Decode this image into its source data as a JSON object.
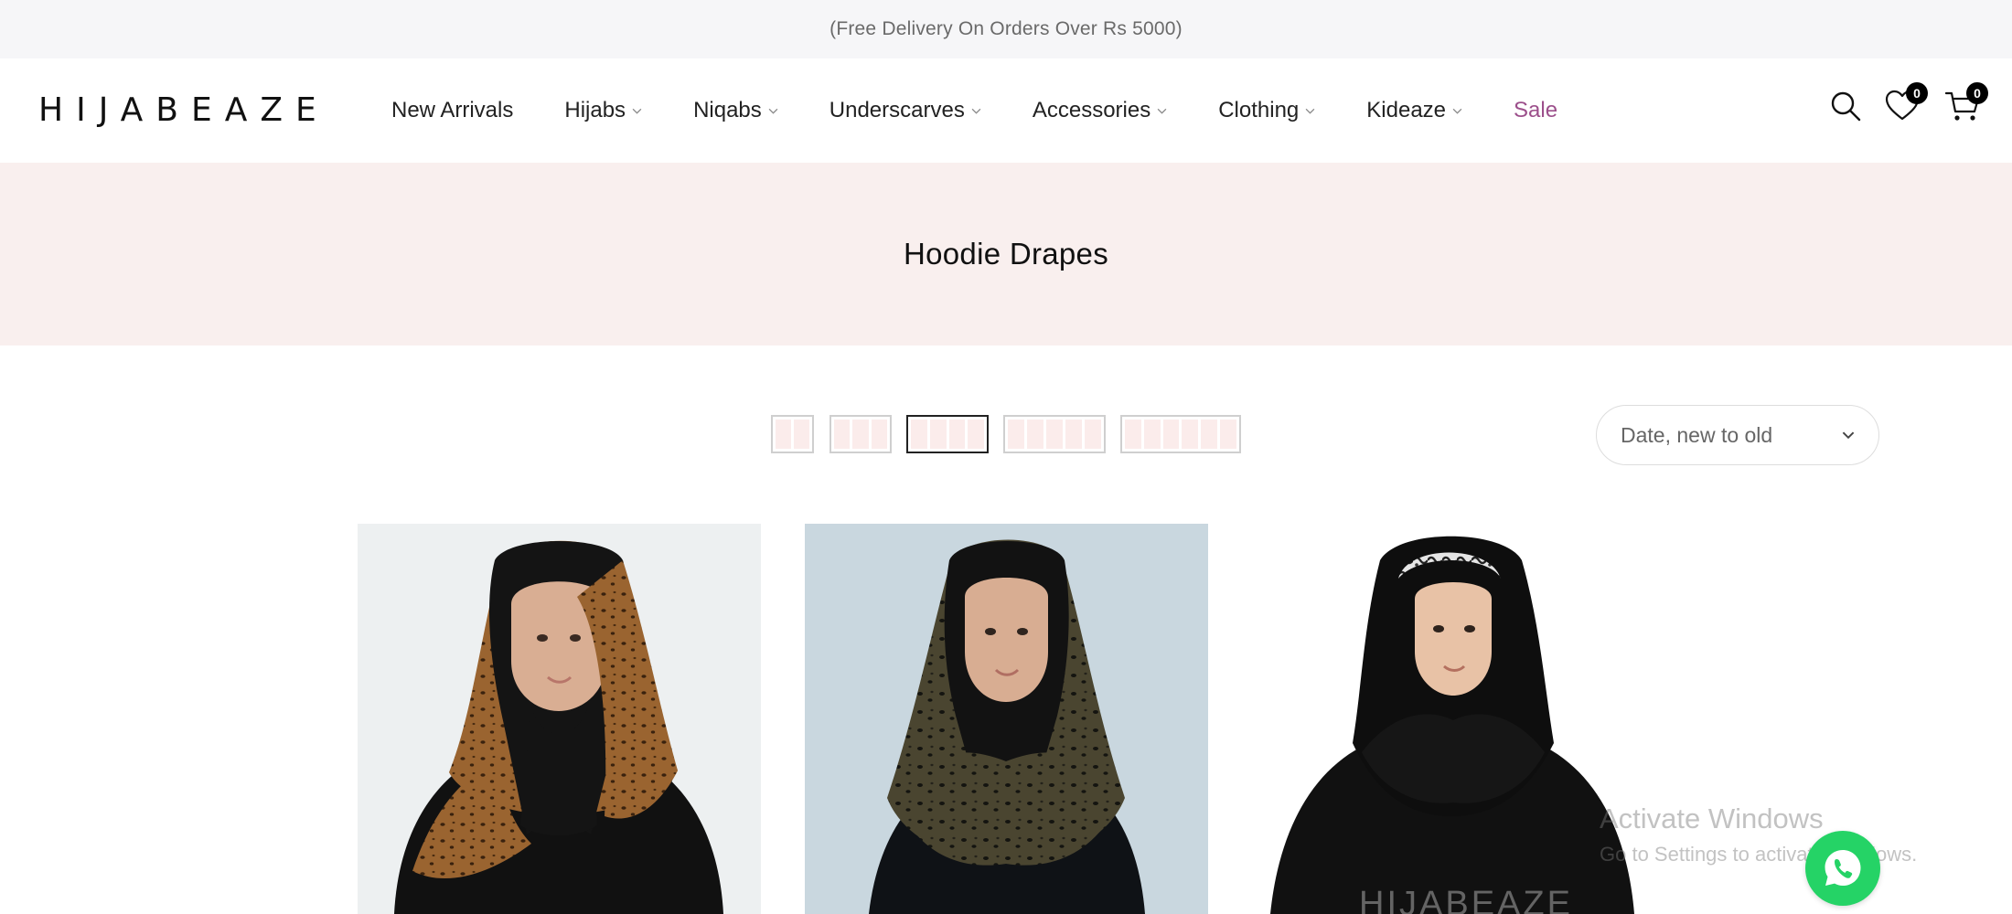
{
  "announcement": "(Free Delivery On Orders Over Rs 5000)",
  "logo": "HIJABEAZE",
  "nav": [
    {
      "label": "New Arrivals",
      "has_dropdown": false
    },
    {
      "label": "Hijabs",
      "has_dropdown": true
    },
    {
      "label": "Niqabs",
      "has_dropdown": true
    },
    {
      "label": "Underscarves",
      "has_dropdown": true
    },
    {
      "label": "Accessories",
      "has_dropdown": true
    },
    {
      "label": "Clothing",
      "has_dropdown": true
    },
    {
      "label": "Kideaze",
      "has_dropdown": true
    },
    {
      "label": "Sale",
      "has_dropdown": false,
      "color": "#9c4f8b"
    }
  ],
  "header_icons": {
    "search": "search-icon",
    "wishlist": {
      "icon": "heart-icon",
      "count": "0"
    },
    "cart": {
      "icon": "cart-icon",
      "count": "0"
    }
  },
  "banner": {
    "title": "Hoodie Drapes",
    "background": "#f9efee"
  },
  "grid_options": [
    {
      "columns": 2,
      "active": false
    },
    {
      "columns": 3,
      "active": false
    },
    {
      "columns": 4,
      "active": true
    },
    {
      "columns": 5,
      "active": false
    },
    {
      "columns": 6,
      "active": false
    }
  ],
  "sort": {
    "selected": "Date, new to old"
  },
  "products": [
    {
      "image": "product-image-brown-leopard-hoodie-drape",
      "scarf_color": "#9a6430"
    },
    {
      "image": "product-image-olive-leopard-hoodie-drape",
      "scarf_color": "#3e3a26"
    },
    {
      "image": "product-image-black-hoodie-drape",
      "scarf_color": "#141414",
      "watermark": "HIJABEAZE"
    }
  ],
  "os_watermark": {
    "line1": "Activate Windows",
    "line2": "Go to Settings to activate Windows."
  },
  "whatsapp": "whatsapp-icon"
}
